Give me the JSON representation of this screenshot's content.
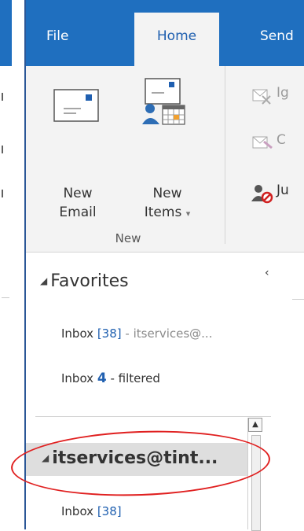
{
  "ribbon": {
    "tabs": [
      {
        "label": "File"
      },
      {
        "label": "Home"
      },
      {
        "label": "Send"
      }
    ],
    "new_group": {
      "label": "New",
      "new_email": {
        "line1": "New",
        "line2": "Email"
      },
      "new_items": {
        "line1": "New",
        "line2": "Items",
        "caret": "▾"
      }
    },
    "delete_group": {
      "ignore": {
        "label": "Ig"
      },
      "cleanup": {
        "label": "C"
      },
      "junk": {
        "label": "Ju"
      }
    }
  },
  "folder_pane": {
    "collapse_glyph": "‹",
    "favorites": {
      "label": "Favorites",
      "items": [
        {
          "name": "Inbox",
          "count": "[38]",
          "suffix": " - itservices@..."
        },
        {
          "name": "Inbox",
          "count": "4",
          "suffix": " - filtered"
        }
      ]
    },
    "account": {
      "label": "itservices@tint...",
      "items": [
        {
          "name": "Inbox",
          "count": "[38]"
        }
      ]
    }
  },
  "colors": {
    "ribbon_blue": "#1f6fbf",
    "active_tab_text": "#2060b0",
    "annotation_red": "#e02020"
  }
}
